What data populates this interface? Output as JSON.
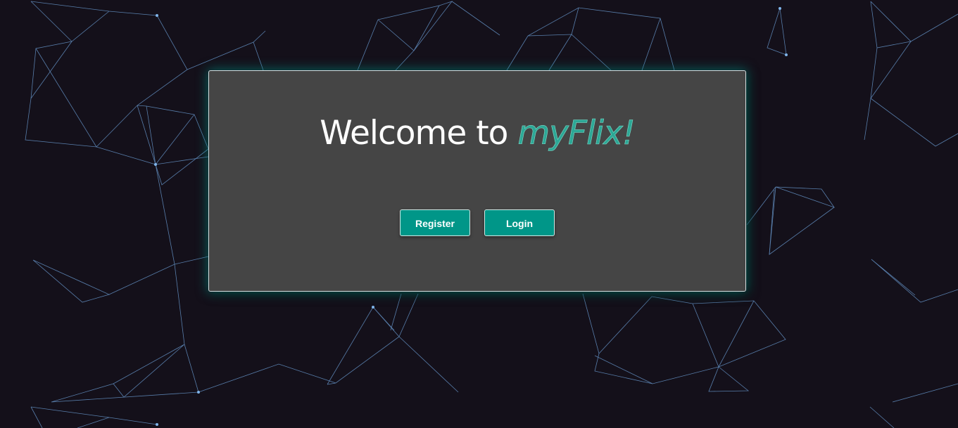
{
  "page": {
    "accent_color": "#009688",
    "background_color": "#14101a",
    "card_color": "#454545"
  },
  "welcome": {
    "prefix": "Welcome to ",
    "brand": "myFlix!"
  },
  "actions": {
    "register_label": "Register",
    "login_label": "Login"
  }
}
